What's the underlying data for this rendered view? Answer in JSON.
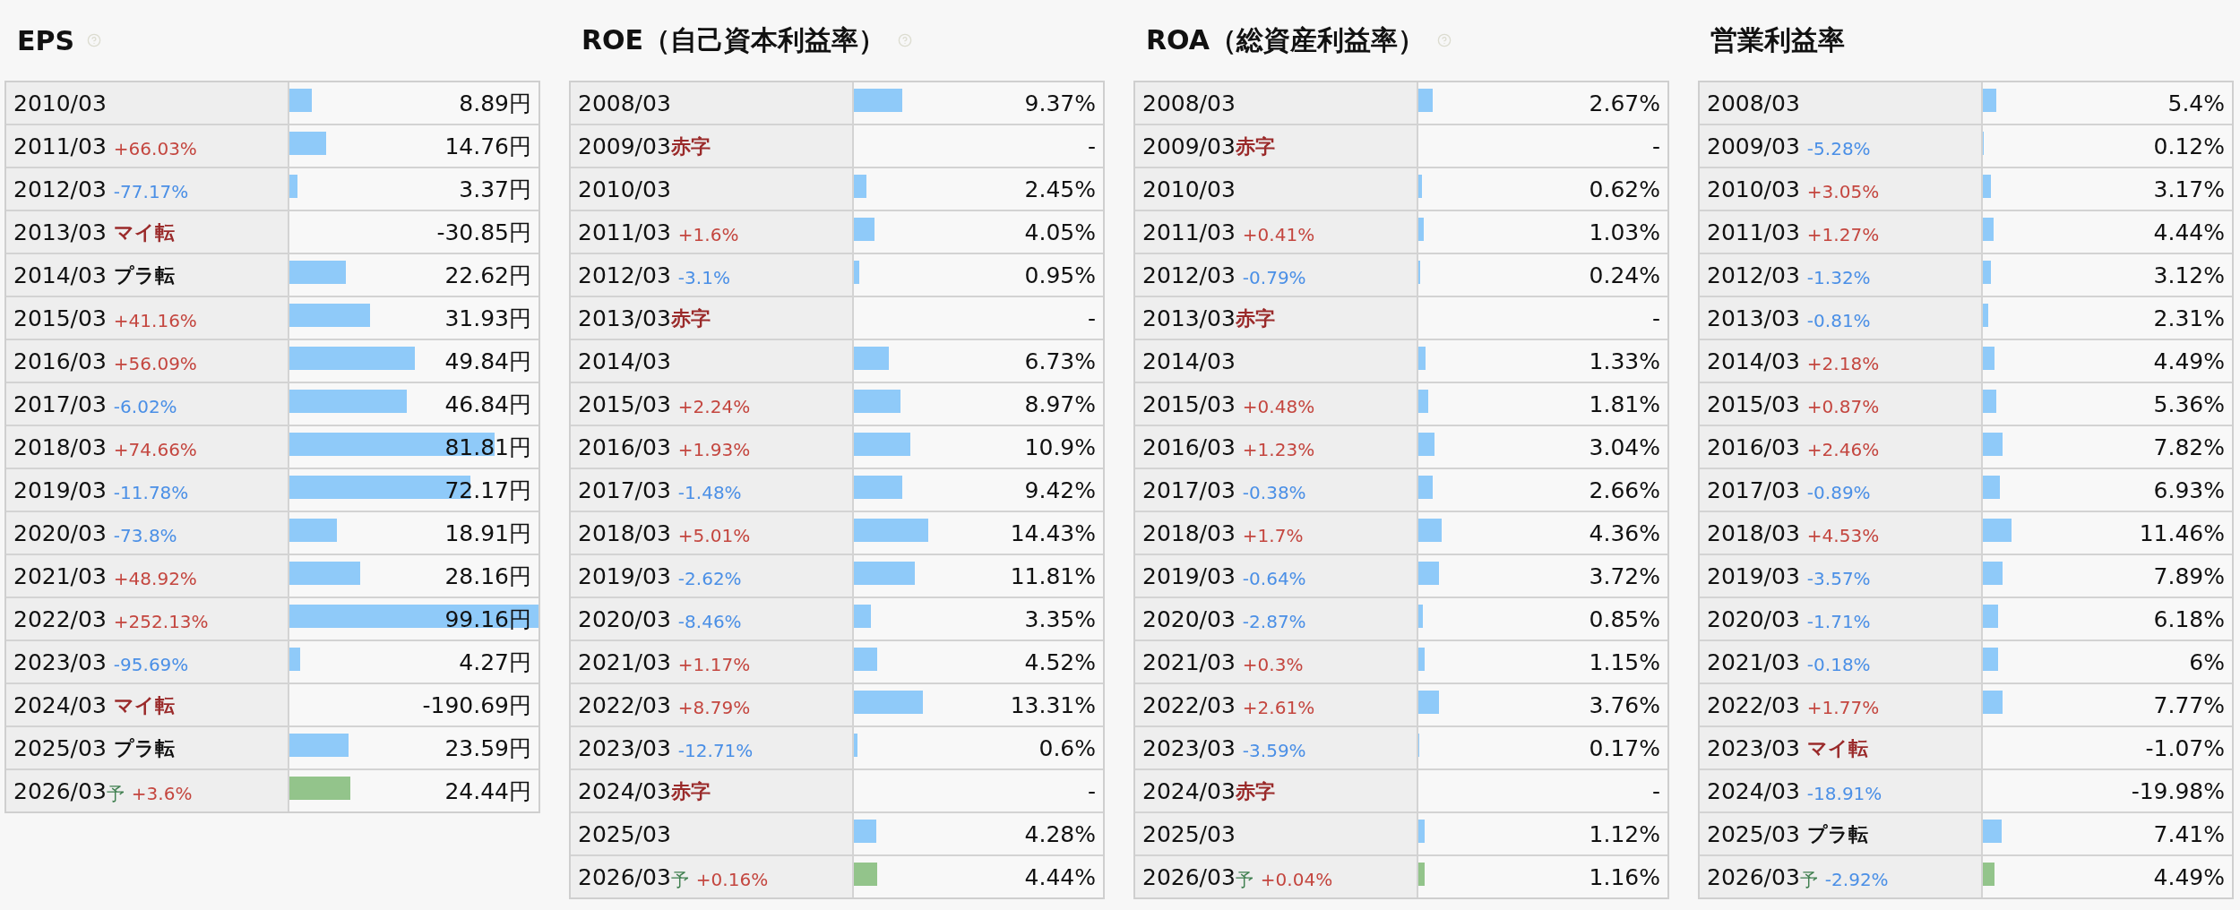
{
  "panels": [
    {
      "title": "EPS",
      "has_help": true,
      "rows": [
        {
          "period": "2010/03",
          "value": "8.89円",
          "level": 0.09
        },
        {
          "period": "2011/03",
          "note": {
            "text": "+66.03%",
            "kind": "up"
          },
          "value": "14.76円",
          "level": 0.149
        },
        {
          "period": "2012/03",
          "note": {
            "text": "-77.17%",
            "kind": "down"
          },
          "value": "3.37円",
          "level": 0.034
        },
        {
          "period": "2013/03",
          "note": {
            "text": "マイ転",
            "kind": "to_minus"
          },
          "value": "-30.85円"
        },
        {
          "period": "2014/03",
          "note": {
            "text": "プラ転",
            "kind": "to_plus"
          },
          "value": "22.62円",
          "level": 0.228
        },
        {
          "period": "2015/03",
          "note": {
            "text": "+41.16%",
            "kind": "up"
          },
          "value": "31.93円",
          "level": 0.322
        },
        {
          "period": "2016/03",
          "note": {
            "text": "+56.09%",
            "kind": "up"
          },
          "value": "49.84円",
          "level": 0.503
        },
        {
          "period": "2017/03",
          "note": {
            "text": "-6.02%",
            "kind": "down"
          },
          "value": "46.84円",
          "level": 0.472
        },
        {
          "period": "2018/03",
          "note": {
            "text": "+74.66%",
            "kind": "up"
          },
          "value": "81.81円",
          "level": 0.825
        },
        {
          "period": "2019/03",
          "note": {
            "text": "-11.78%",
            "kind": "down"
          },
          "value": "72.17円",
          "level": 0.728
        },
        {
          "period": "2020/03",
          "note": {
            "text": "-73.8%",
            "kind": "down"
          },
          "value": "18.91円",
          "level": 0.191
        },
        {
          "period": "2021/03",
          "note": {
            "text": "+48.92%",
            "kind": "up"
          },
          "value": "28.16円",
          "level": 0.284
        },
        {
          "period": "2022/03",
          "note": {
            "text": "+252.13%",
            "kind": "up"
          },
          "value": "99.16円",
          "level": 1
        },
        {
          "period": "2023/03",
          "note": {
            "text": "-95.69%",
            "kind": "down"
          },
          "value": "4.27円",
          "level": 0.043
        },
        {
          "period": "2024/03",
          "note": {
            "text": "マイ転",
            "kind": "to_minus"
          },
          "value": "-190.69円"
        },
        {
          "period": "2025/03",
          "note": {
            "text": "プラ転",
            "kind": "to_plus"
          },
          "value": "23.59円",
          "level": 0.238
        },
        {
          "period": "2026/03",
          "forecast_mark": "予",
          "note": {
            "text": "+3.6%",
            "kind": "up"
          },
          "value": "24.44円",
          "level": 0.246
        }
      ]
    },
    {
      "title": "ROE（自己資本利益率）",
      "has_help": true,
      "rows": [
        {
          "period": "2008/03",
          "value": "9.37%",
          "level": 0.195
        },
        {
          "period": "2009/03",
          "note": {
            "text": "赤字",
            "kind": "deficit"
          },
          "value": "-"
        },
        {
          "period": "2010/03",
          "value": "2.45%",
          "level": 0.051
        },
        {
          "period": "2011/03",
          "note": {
            "text": "+1.6%",
            "kind": "up"
          },
          "value": "4.05%",
          "level": 0.084
        },
        {
          "period": "2012/03",
          "note": {
            "text": "-3.1%",
            "kind": "down"
          },
          "value": "0.95%",
          "level": 0.02
        },
        {
          "period": "2013/03",
          "note": {
            "text": "赤字",
            "kind": "deficit"
          },
          "value": "-"
        },
        {
          "period": "2014/03",
          "value": "6.73%",
          "level": 0.14
        },
        {
          "period": "2015/03",
          "note": {
            "text": "+2.24%",
            "kind": "up"
          },
          "value": "8.97%",
          "level": 0.187
        },
        {
          "period": "2016/03",
          "note": {
            "text": "+1.93%",
            "kind": "up"
          },
          "value": "10.9%",
          "level": 0.227
        },
        {
          "period": "2017/03",
          "note": {
            "text": "-1.48%",
            "kind": "down"
          },
          "value": "9.42%",
          "level": 0.196
        },
        {
          "period": "2018/03",
          "note": {
            "text": "+5.01%",
            "kind": "up"
          },
          "value": "14.43%",
          "level": 0.3
        },
        {
          "period": "2019/03",
          "note": {
            "text": "-2.62%",
            "kind": "down"
          },
          "value": "11.81%",
          "level": 0.246
        },
        {
          "period": "2020/03",
          "note": {
            "text": "-8.46%",
            "kind": "down"
          },
          "value": "3.35%",
          "level": 0.07
        },
        {
          "period": "2021/03",
          "note": {
            "text": "+1.17%",
            "kind": "up"
          },
          "value": "4.52%",
          "level": 0.094
        },
        {
          "period": "2022/03",
          "note": {
            "text": "+8.79%",
            "kind": "up"
          },
          "value": "13.31%",
          "level": 0.277
        },
        {
          "period": "2023/03",
          "note": {
            "text": "-12.71%",
            "kind": "down"
          },
          "value": "0.6%",
          "level": 0.013
        },
        {
          "period": "2024/03",
          "note": {
            "text": "赤字",
            "kind": "deficit"
          },
          "value": "-"
        },
        {
          "period": "2025/03",
          "value": "4.28%",
          "level": 0.089
        },
        {
          "period": "2026/03",
          "forecast_mark": "予",
          "note": {
            "text": "+0.16%",
            "kind": "up"
          },
          "value": "4.44%",
          "level": 0.093
        }
      ]
    },
    {
      "title": "ROA（総資産利益率）",
      "has_help": true,
      "rows": [
        {
          "period": "2008/03",
          "value": "2.67%",
          "level": 0.058
        },
        {
          "period": "2009/03",
          "note": {
            "text": "赤字",
            "kind": "deficit"
          },
          "value": "-"
        },
        {
          "period": "2010/03",
          "value": "0.62%",
          "level": 0.013
        },
        {
          "period": "2011/03",
          "note": {
            "text": "+0.41%",
            "kind": "up"
          },
          "value": "1.03%",
          "level": 0.022
        },
        {
          "period": "2012/03",
          "note": {
            "text": "-0.79%",
            "kind": "down"
          },
          "value": "0.24%",
          "level": 0.006
        },
        {
          "period": "2013/03",
          "note": {
            "text": "赤字",
            "kind": "deficit"
          },
          "value": "-"
        },
        {
          "period": "2014/03",
          "value": "1.33%",
          "level": 0.029
        },
        {
          "period": "2015/03",
          "note": {
            "text": "+0.48%",
            "kind": "up"
          },
          "value": "1.81%",
          "level": 0.039
        },
        {
          "period": "2016/03",
          "note": {
            "text": "+1.23%",
            "kind": "up"
          },
          "value": "3.04%",
          "level": 0.066
        },
        {
          "period": "2017/03",
          "note": {
            "text": "-0.38%",
            "kind": "down"
          },
          "value": "2.66%",
          "level": 0.058
        },
        {
          "period": "2018/03",
          "note": {
            "text": "+1.7%",
            "kind": "up"
          },
          "value": "4.36%",
          "level": 0.095
        },
        {
          "period": "2019/03",
          "note": {
            "text": "-0.64%",
            "kind": "down"
          },
          "value": "3.72%",
          "level": 0.081
        },
        {
          "period": "2020/03",
          "note": {
            "text": "-2.87%",
            "kind": "down"
          },
          "value": "0.85%",
          "level": 0.018
        },
        {
          "period": "2021/03",
          "note": {
            "text": "+0.3%",
            "kind": "up"
          },
          "value": "1.15%",
          "level": 0.025
        },
        {
          "period": "2022/03",
          "note": {
            "text": "+2.61%",
            "kind": "up"
          },
          "value": "3.76%",
          "level": 0.082
        },
        {
          "period": "2023/03",
          "note": {
            "text": "-3.59%",
            "kind": "down"
          },
          "value": "0.17%",
          "level": 0.004
        },
        {
          "period": "2024/03",
          "note": {
            "text": "赤字",
            "kind": "deficit"
          },
          "value": "-"
        },
        {
          "period": "2025/03",
          "value": "1.12%",
          "level": 0.024
        },
        {
          "period": "2026/03",
          "forecast_mark": "予",
          "note": {
            "text": "+0.04%",
            "kind": "up"
          },
          "value": "1.16%",
          "level": 0.025
        }
      ]
    },
    {
      "title": "営業利益率",
      "rows": [
        {
          "period": "2008/03",
          "value": "5.4%",
          "level": 0.054
        },
        {
          "period": "2009/03",
          "note": {
            "text": "-5.28%",
            "kind": "down"
          },
          "value": "0.12%",
          "level": 0.002
        },
        {
          "period": "2010/03",
          "note": {
            "text": "+3.05%",
            "kind": "up"
          },
          "value": "3.17%",
          "level": 0.032
        },
        {
          "period": "2011/03",
          "note": {
            "text": "+1.27%",
            "kind": "up"
          },
          "value": "4.44%",
          "level": 0.044
        },
        {
          "period": "2012/03",
          "note": {
            "text": "-1.32%",
            "kind": "down"
          },
          "value": "3.12%",
          "level": 0.031
        },
        {
          "period": "2013/03",
          "note": {
            "text": "-0.81%",
            "kind": "down"
          },
          "value": "2.31%",
          "level": 0.023
        },
        {
          "period": "2014/03",
          "note": {
            "text": "+2.18%",
            "kind": "up"
          },
          "value": "4.49%",
          "level": 0.045
        },
        {
          "period": "2015/03",
          "note": {
            "text": "+0.87%",
            "kind": "up"
          },
          "value": "5.36%",
          "level": 0.054
        },
        {
          "period": "2016/03",
          "note": {
            "text": "+2.46%",
            "kind": "up"
          },
          "value": "7.82%",
          "level": 0.078
        },
        {
          "period": "2017/03",
          "note": {
            "text": "-0.89%",
            "kind": "down"
          },
          "value": "6.93%",
          "level": 0.069
        },
        {
          "period": "2018/03",
          "note": {
            "text": "+4.53%",
            "kind": "up"
          },
          "value": "11.46%",
          "level": 0.115
        },
        {
          "period": "2019/03",
          "note": {
            "text": "-3.57%",
            "kind": "down"
          },
          "value": "7.89%",
          "level": 0.079
        },
        {
          "period": "2020/03",
          "note": {
            "text": "-1.71%",
            "kind": "down"
          },
          "value": "6.18%",
          "level": 0.062
        },
        {
          "period": "2021/03",
          "note": {
            "text": "-0.18%",
            "kind": "down"
          },
          "value": "6%",
          "level": 0.06
        },
        {
          "period": "2022/03",
          "note": {
            "text": "+1.77%",
            "kind": "up"
          },
          "value": "7.77%",
          "level": 0.078
        },
        {
          "period": "2023/03",
          "note": {
            "text": "マイ転",
            "kind": "to_minus"
          },
          "value": "-1.07%"
        },
        {
          "period": "2024/03",
          "note": {
            "text": "-18.91%",
            "kind": "down"
          },
          "value": "-19.98%"
        },
        {
          "period": "2025/03",
          "note": {
            "text": "プラ転",
            "kind": "to_plus"
          },
          "value": "7.41%",
          "level": 0.074
        },
        {
          "period": "2026/03",
          "forecast_mark": "予",
          "note": {
            "text": "-2.92%",
            "kind": "down"
          },
          "value": "4.49%",
          "level": 0.045
        }
      ]
    }
  ]
}
